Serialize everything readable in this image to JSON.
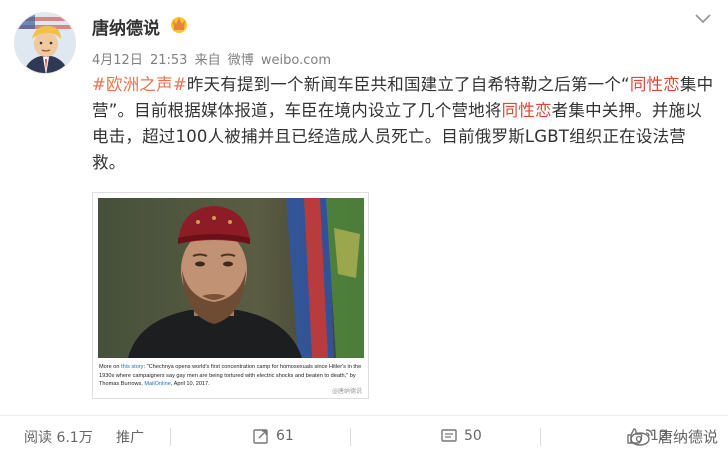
{
  "author": {
    "name": "唐纳德说",
    "vip_badge_icon": "vip-crown-icon",
    "avatar_icon": "cartoon-trump-avatar"
  },
  "meta": {
    "date": "4月12日",
    "time": "21:53",
    "source_prefix": "来自",
    "source": "微博",
    "source_domain": "weibo.com"
  },
  "post": {
    "topic": "#欧洲之声#",
    "text_1": "昨天有提到一个新闻车臣共和国建立了自希特勒之后第一个“",
    "keyword_1": "同性恋",
    "text_2": "集中营”。目前根据媒体报道，车臣在境内设立了几个营地将",
    "keyword_2": "同性恋",
    "text_3": "者集中关押。并施以电击，超过100人被捕并且已经造成人员死亡。目前俄罗斯LGBT组织正在设法营救。",
    "topic_color": "#eb7350",
    "keyword_color": "#e2443a"
  },
  "image": {
    "caption_more": "More on ",
    "caption_link1": "this story",
    "caption_body": ": \"Chechnya opens world's first concentration camp for homosexuals since Hitler's in the 1930s where campaigners say gay men are being tortured with electric shocks and beaten to death,\" by Thomas Burrows, ",
    "caption_link2": "MailOnline",
    "caption_date": ", April 10, 2017.",
    "watermark": "@唐纳德说"
  },
  "actions": {
    "reads": "阅读 6.1万",
    "promote": "推广",
    "reposts": "61",
    "comments": "50",
    "likes": "12"
  },
  "watermark": {
    "text": "唐纳德说"
  }
}
